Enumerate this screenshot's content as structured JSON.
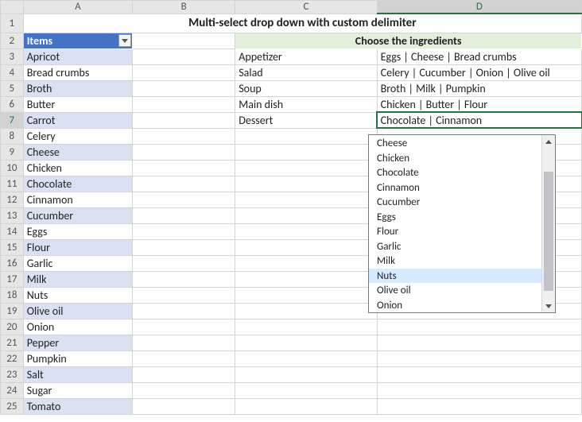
{
  "columns": [
    "A",
    "B",
    "C",
    "D"
  ],
  "title": "Multi-select drop down with custom delimiter",
  "items_header": "Items",
  "choose_header": "Choose the ingredients",
  "items": [
    "Apricot",
    "Bread crumbs",
    "Broth",
    "Butter",
    "Carrot",
    "Celery",
    "Cheese",
    "Chicken",
    "Chocolate",
    "Cinnamon",
    "Cucumber",
    "Eggs",
    "Flour",
    "Garlic",
    "Milk",
    "Nuts",
    "Olive oil",
    "Onion",
    "Pepper",
    "Pumpkin",
    "Salt",
    "Sugar",
    "Tomato"
  ],
  "dishes": [
    {
      "name": "Appetizer",
      "ing": "Eggs | Cheese | Bread crumbs"
    },
    {
      "name": "Salad",
      "ing": "Celery | Cucumber | Onion | Olive oil"
    },
    {
      "name": "Soup",
      "ing": "Broth | Milk | Pumpkin"
    },
    {
      "name": "Main dish",
      "ing": "Chicken | Butter | Flour"
    },
    {
      "name": "Dessert",
      "ing": "Chocolate | Cinnamon"
    }
  ],
  "dropdown": {
    "options": [
      "Cheese",
      "Chicken",
      "Chocolate",
      "Cinnamon",
      "Cucumber",
      "Eggs",
      "Flour",
      "Garlic",
      "Milk",
      "Nuts",
      "Olive oil",
      "Onion"
    ],
    "highlighted": "Nuts"
  },
  "active_row": 7,
  "active_col": "D"
}
